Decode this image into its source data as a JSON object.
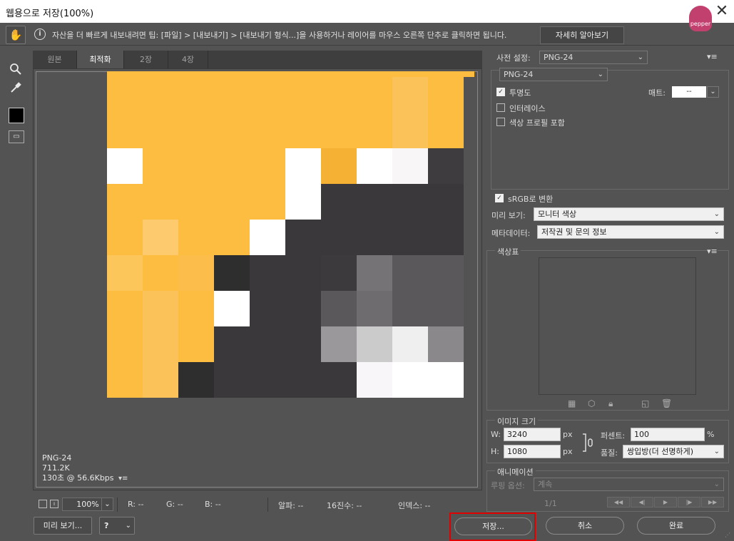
{
  "window": {
    "title": "웹용으로 저장(100%)",
    "close": "✕",
    "brand": "pepper"
  },
  "tip": {
    "text": "자산을 더 빠르게 내보내려면 팁: [파일] > [내보내기] > [내보내기 형식...]을 사용하거나 레이어를 마우스 오른쪽 단추로 클릭하면 됩니다.",
    "learn_more": "자세히 알아보기"
  },
  "tabs": [
    "원본",
    "최적화",
    "2장",
    "4장"
  ],
  "active_tab": 1,
  "preview_info": {
    "format": "PNG-24",
    "size": "711.2K",
    "time": "130초 @ 56.6Kbps"
  },
  "pixel_grid": {
    "cols": 10,
    "rows": 9,
    "colors": [
      [
        "#fcbd40",
        "#fcbd40",
        "#fcbd40",
        "#fcbd40",
        "#fcbd40",
        "#fcbd40",
        "#fcbd40",
        "#fcbd40",
        "#fcc25a",
        "#fcbd40"
      ],
      [
        "#fcbd40",
        "#fcbd40",
        "#fcbd40",
        "#fcbd40",
        "#fcbd40",
        "#fcbd40",
        "#fcbd40",
        "#fcbd40",
        "#fcc25a",
        "#fcbd40"
      ],
      [
        "#ffffff",
        "#fcbd40",
        "#fcbd40",
        "#fcbd40",
        "#fcbd40",
        "#ffffff",
        "#f4b133",
        "#ffffff",
        "#f8f6f7",
        "#3f3c3f"
      ],
      [
        "#fcbd40",
        "#fcbd40",
        "#fcbd40",
        "#fcbd40",
        "#fcbd40",
        "#ffffff",
        "#3b383b",
        "#3b383b",
        "#3b383b",
        "#3b383b"
      ],
      [
        "#fcbd40",
        "#fdca6d",
        "#fcbd40",
        "#fcbd40",
        "#ffffff",
        "#3b383b",
        "#3b383b",
        "#3b383b",
        "#3b383b",
        "#3b383b"
      ],
      [
        "#fcc65a",
        "#fcbd40",
        "#fcbd4a",
        "#2f2e2f",
        "#3b383b",
        "#3b383b",
        "#3d3a3d",
        "#757375",
        "#5a585a",
        "#5a585a"
      ],
      [
        "#fcbd40",
        "#fcc25a",
        "#fcbd40",
        "#ffffff",
        "#3b383b",
        "#3b383b",
        "#5a585a",
        "#6e6c6e",
        "#5a585a",
        "#5a585a"
      ],
      [
        "#fcbd40",
        "#fcc25a",
        "#fcbd40",
        "#3b383b",
        "#3b383b",
        "#3b383b",
        "#9a989a",
        "#cccbcc",
        "#f0eff0",
        "#8a888a"
      ],
      [
        "#fcbd40",
        "#fcc25a",
        "#2f2e2f",
        "#3b383b",
        "#3b383b",
        "#3b383b",
        "#3b383b",
        "#f8f6f8",
        "#ffffff",
        "#ffffff"
      ]
    ]
  },
  "status": {
    "zoom": "100%",
    "r": "R: --",
    "g": "G: --",
    "b": "B: --",
    "alpha": "알파: --",
    "hex": "16진수: --",
    "index": "인덱스: --"
  },
  "bottom": {
    "preview": "미리 보기...",
    "help": "?",
    "save": "저장...",
    "cancel": "취소",
    "done": "완료"
  },
  "right": {
    "preset_label": "사전 설정:",
    "preset_value": "PNG-24",
    "format_value": "PNG-24",
    "transparency": "투명도",
    "matte_label": "매트:",
    "matte_value": "--",
    "interlace": "인터레이스",
    "embed_profile": "색상 프로필 포함",
    "srgb": "sRGB로 변환",
    "preview_label": "미리 보기:",
    "preview_value": "모니터 색상",
    "metadata_label": "메타데이터:",
    "metadata_value": "저작권 및 문의 정보",
    "color_table_label": "색상표",
    "image_size_label": "이미지 크기",
    "w_label": "W:",
    "w_value": "3240",
    "w_unit": "px",
    "h_label": "H:",
    "h_value": "1080",
    "h_unit": "px",
    "percent_label": "퍼센트:",
    "percent_value": "100",
    "percent_unit": "%",
    "quality_label": "품질:",
    "quality_value": "쌍입방(더 선명하게)",
    "animation_label": "애니메이션",
    "loop_label": "루핑 옵션:",
    "loop_value": "계속",
    "frame_counter": "1/1"
  }
}
